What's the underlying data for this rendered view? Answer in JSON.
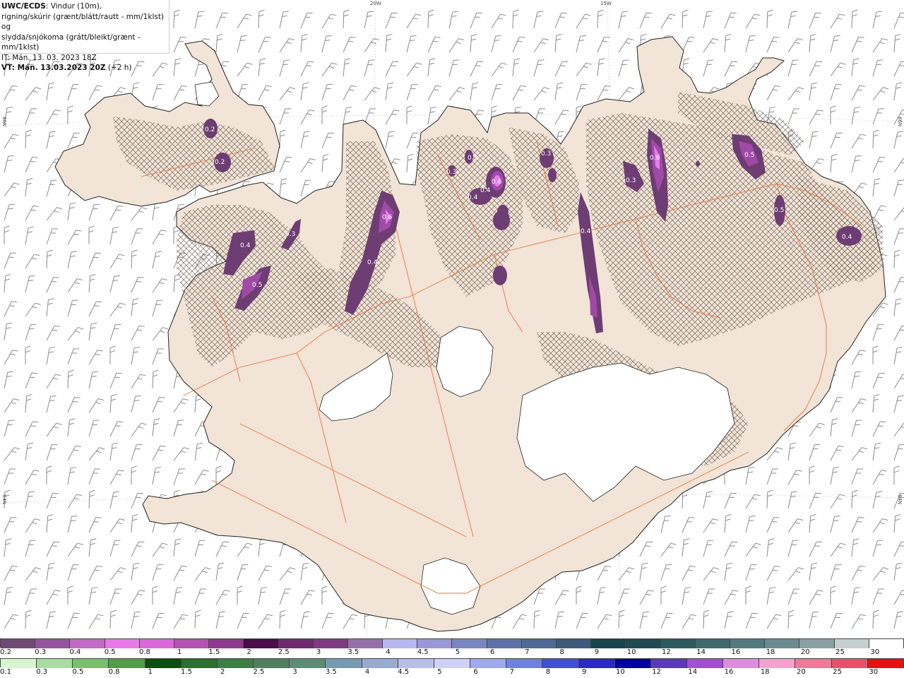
{
  "title": {
    "line1_bold": "UWC/ECDS",
    "line1_rest": ": Vindur (10m),",
    "line2": "rigning/skúrir (grænt/blátt/rautt - mm/1klst) og",
    "line3": "slydda/snjókoma (grátt/bleikt/grænt - mm/1klst)",
    "line4": "IT: Mán. 13. 03. 2023 18Z",
    "line5_bold": "VT: Mán. 13.03.2023 20Z",
    "line5_rest": " (+2 h)"
  },
  "coords": {
    "top_20w": "20W",
    "top_15w": "15W",
    "left_66n": "66N",
    "left_64n": "64N",
    "right_66n": "66N",
    "right_64n": "64N"
  },
  "colors": {
    "land": "#f2e4d6",
    "coast": "#222222",
    "roads": "#e8733e",
    "wind_barb": "#8a8a8a",
    "precip_light": "#6e3d73",
    "precip_mid": "#a04aa8",
    "precip_high": "#e47ce8",
    "hatch": "#7a6a60"
  },
  "precip_values": [
    {
      "label": "0.2"
    },
    {
      "label": "0.2"
    },
    {
      "label": "0.3"
    },
    {
      "label": "0.4"
    },
    {
      "label": "0.5"
    },
    {
      "label": "0.6"
    },
    {
      "label": "0.4"
    },
    {
      "label": "0.3"
    },
    {
      "label": "0.4"
    },
    {
      "label": "0.6"
    },
    {
      "label": "0.3"
    },
    {
      "label": "0.3"
    },
    {
      "label": "0.6"
    },
    {
      "label": "0.3"
    },
    {
      "label": "0.4"
    },
    {
      "label": "0.4"
    },
    {
      "label": "0.5"
    },
    {
      "label": "0.5"
    },
    {
      "label": "0.4"
    }
  ],
  "legend_snow": {
    "labels": [
      "0.2",
      "0.3",
      "0.4",
      "0.5",
      "0.8",
      "1",
      "1.5",
      "2",
      "2.5",
      "3",
      "3.5",
      "4",
      "4.5",
      "5",
      "6",
      "7",
      "8",
      "9",
      "10",
      "12",
      "14",
      "16",
      "18",
      "20",
      "25",
      "30"
    ],
    "colors": [
      "#6e4a73",
      "#94549b",
      "#c06ac4",
      "#e87ae8",
      "#d86ad8",
      "#b452b4",
      "#8c3a8c",
      "#4a0d4a",
      "#6e2a6e",
      "#7e3a80",
      "#9470a8",
      "#b8b8f0",
      "#9898d8",
      "#7a86c0",
      "#5e70a8",
      "#4e6a92",
      "#3e5a78",
      "#16434c",
      "#1e4a50",
      "#2a5a5e",
      "#3e6a6e",
      "#527a7e",
      "#6a8a8e",
      "#8aa0a2",
      "#c6d0d0",
      "#ffffff"
    ]
  },
  "legend_rain": {
    "labels": [
      "0.1",
      "0.3",
      "0.5",
      "0.8",
      "1",
      "1.5",
      "2",
      "2.5",
      "3",
      "3.5",
      "4",
      "4.5",
      "5",
      "6",
      "7",
      "8",
      "9",
      "10",
      "12",
      "14",
      "16",
      "18",
      "20",
      "25",
      "30"
    ],
    "colors": [
      "#d8f4d0",
      "#a8dca0",
      "#78c070",
      "#4e9e4a",
      "#0e4e0e",
      "#2e6e2e",
      "#3e7e46",
      "#527e5e",
      "#5e8a78",
      "#789ab0",
      "#98aad0",
      "#b8c0e8",
      "#d0d0f8",
      "#a0a8f0",
      "#7080e0",
      "#4050d0",
      "#2a2ac0",
      "#00009e",
      "#5a3ab8",
      "#a050d0",
      "#e08ae0",
      "#f8a0d0",
      "#f07898",
      "#e8506a",
      "#e81010"
    ]
  }
}
